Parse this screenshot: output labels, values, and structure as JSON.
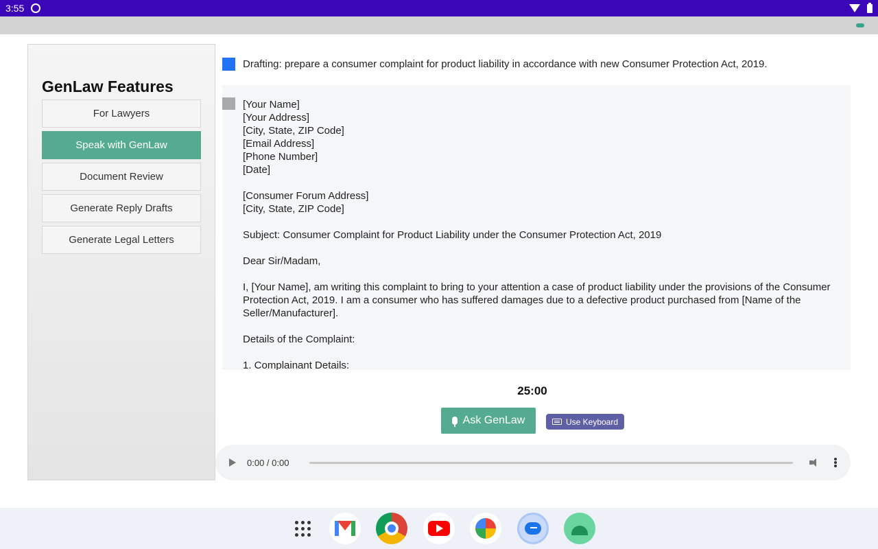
{
  "status_bar": {
    "time": "3:55"
  },
  "sidebar": {
    "title": "GenLaw Features",
    "items": [
      {
        "label": "For Lawyers",
        "active": false
      },
      {
        "label": "Speak with GenLaw",
        "active": true
      },
      {
        "label": "Document Review",
        "active": false
      },
      {
        "label": "Generate Reply Drafts",
        "active": false
      },
      {
        "label": "Generate Legal Letters",
        "active": false
      }
    ]
  },
  "conversation": {
    "prompt": "Drafting: prepare a consumer complaint for product liability in accordance with new Consumer Protection Act, 2019.",
    "response": "[Your Name]\n[Your Address]\n[City, State, ZIP Code]\n[Email Address]\n[Phone Number]\n[Date]\n\n[Consumer Forum Address]\n[City, State, ZIP Code]\n\nSubject: Consumer Complaint for Product Liability under the Consumer Protection Act, 2019\n\nDear Sir/Madam,\n\nI, [Your Name], am writing this complaint to bring to your attention a case of product liability under the provisions of the Consumer Protection Act, 2019. I am a consumer who has suffered damages due to a defective product purchased from [Name of the Seller/Manufacturer].\n\nDetails of the Complaint:\n\n1. Complainant Details:"
  },
  "controls": {
    "timer": "25:00",
    "ask_label": "Ask GenLaw",
    "keyboard_label": "Use Keyboard"
  },
  "audio_player": {
    "time": "0:00 / 0:00"
  },
  "dock": {
    "apps": [
      "apps-grid-icon",
      "gmail-icon",
      "chrome-icon",
      "youtube-icon",
      "photos-icon",
      "messages-icon",
      "android-icon"
    ]
  },
  "colors": {
    "status_bar": "#3b06b8",
    "accent": "#55ab8f",
    "keyboard_button": "#5f5fa6",
    "prompt_marker": "#1e74f5"
  }
}
